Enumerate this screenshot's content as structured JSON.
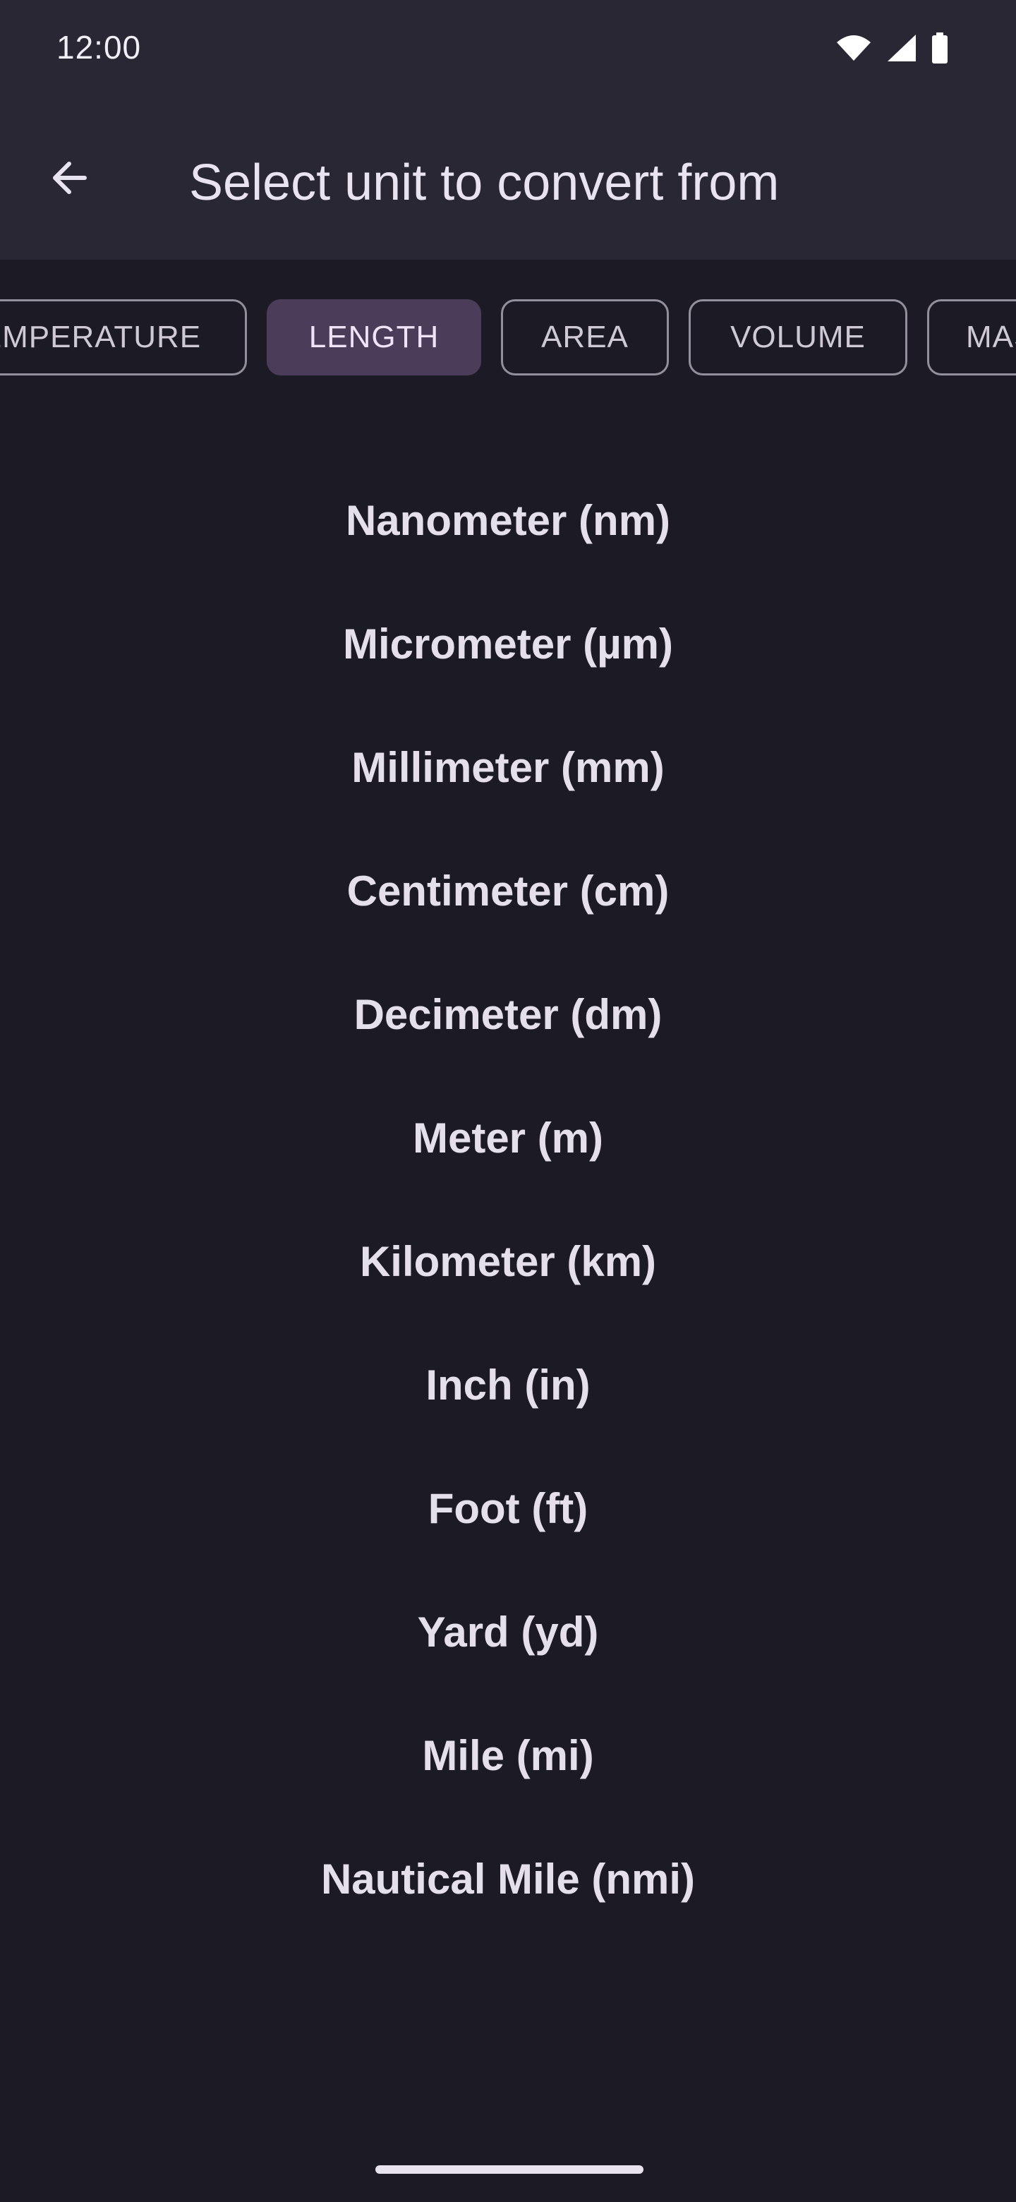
{
  "status_bar": {
    "time": "12:00",
    "icons": [
      "wifi-icon",
      "signal-icon",
      "battery-icon"
    ]
  },
  "header": {
    "title": "Select unit to convert from",
    "back_icon": "arrow-left-icon"
  },
  "categories": [
    {
      "label": "TEMPERATURE",
      "selected": false
    },
    {
      "label": "LENGTH",
      "selected": true
    },
    {
      "label": "AREA",
      "selected": false
    },
    {
      "label": "VOLUME",
      "selected": false
    },
    {
      "label": "MASS",
      "selected": false
    }
  ],
  "units": [
    "Nanometer (nm)",
    "Micrometer (µm)",
    "Millimeter (mm)",
    "Centimeter (cm)",
    "Decimeter (dm)",
    "Meter (m)",
    "Kilometer (km)",
    "Inch (in)",
    "Foot (ft)",
    "Yard (yd)",
    "Mile (mi)",
    "Nautical Mile (nmi)"
  ],
  "colors": {
    "background": "#1c1a25",
    "topbar": "#2a2735",
    "chip_selected": "#4b3d59"
  }
}
